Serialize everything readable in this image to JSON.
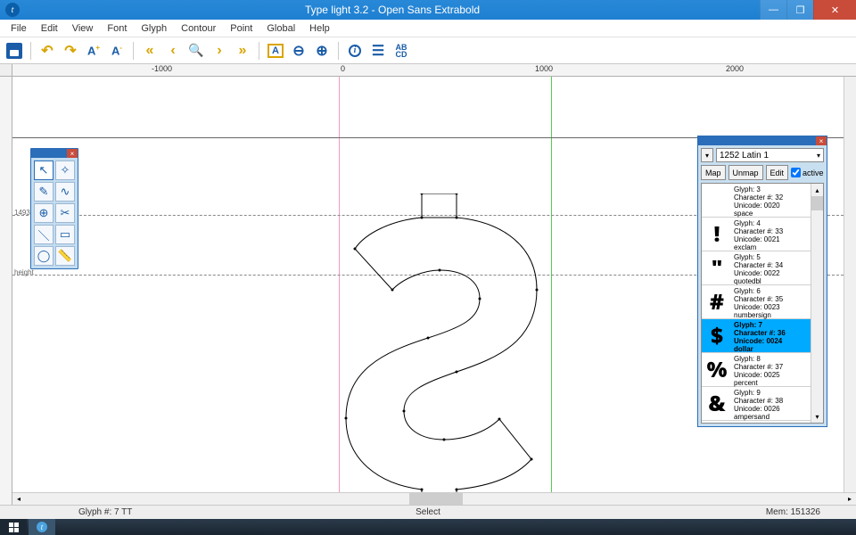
{
  "window": {
    "title": "Type light 3.2  -  Open Sans Extrabold"
  },
  "menubar": [
    "File",
    "Edit",
    "View",
    "Font",
    "Glyph",
    "Contour",
    "Point",
    "Global",
    "Help"
  ],
  "ruler": {
    "ticks": [
      "-1000",
      "0",
      "1000",
      "2000"
    ]
  },
  "guides": {
    "left_label": "1493",
    "right_label": "height"
  },
  "toolbox": {
    "tools": [
      "pointer",
      "node-select",
      "pen-corner",
      "pen-curve",
      "add-point",
      "remove-point",
      "line",
      "rectangle",
      "ellipse",
      "ruler"
    ]
  },
  "glyphpanel": {
    "encoding_dropdown": "1252 Latin 1",
    "buttons": {
      "map": "Map",
      "unmap": "Unmap",
      "edit": "Edit"
    },
    "active_label": "active",
    "active_checked": true,
    "items": [
      {
        "glyph": " ",
        "l1": "Glyph: 3",
        "l2": "Character #: 32",
        "l3": "Unicode: 0020",
        "l4": "space",
        "selected": false
      },
      {
        "glyph": "!",
        "l1": "Glyph: 4",
        "l2": "Character #: 33",
        "l3": "Unicode: 0021",
        "l4": "exclam",
        "selected": false
      },
      {
        "glyph": "\"",
        "l1": "Glyph: 5",
        "l2": "Character #: 34",
        "l3": "Unicode: 0022",
        "l4": "quotedbl",
        "selected": false
      },
      {
        "glyph": "#",
        "l1": "Glyph: 6",
        "l2": "Character #: 35",
        "l3": "Unicode: 0023",
        "l4": "numbersign",
        "selected": false
      },
      {
        "glyph": "$",
        "l1": "Glyph: 7",
        "l2": "Character #: 36",
        "l3": "Unicode: 0024",
        "l4": "dollar",
        "selected": true
      },
      {
        "glyph": "%",
        "l1": "Glyph: 8",
        "l2": "Character #: 37",
        "l3": "Unicode: 0025",
        "l4": "percent",
        "selected": false
      },
      {
        "glyph": "&",
        "l1": "Glyph: 9",
        "l2": "Character #: 38",
        "l3": "Unicode: 0026",
        "l4": "ampersand",
        "selected": false
      }
    ]
  },
  "statusbar": {
    "left": "Glyph #: 7    TT",
    "center": "Select",
    "right": "Mem: 151326"
  }
}
